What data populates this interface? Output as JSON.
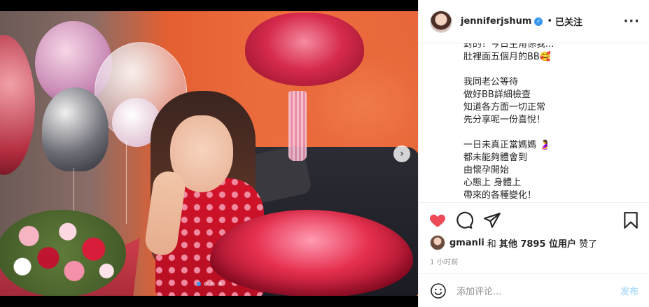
{
  "post": {
    "username": "jenniferjshum",
    "separator": "•",
    "follow_status": "已关注",
    "more_label": "···"
  },
  "caption": {
    "lines": [
      "對的！今日主角係我...",
      "肚裡面五個月的BB🥰",
      "",
      "我同老公等待",
      "做好BB詳細檢查",
      "知道各方面一切正常",
      "先分享呢一份喜悅！",
      "",
      "一日未真正當媽媽 🤰",
      "都未能夠體會到",
      "由懷孕開始",
      "心態上 身體上",
      "帶來的各種變化！"
    ]
  },
  "carousel": {
    "next_arrow": "›",
    "total_slides": 4,
    "active_slide": 1
  },
  "likes": {
    "user": "gmanli",
    "connector": "和",
    "others": "其他 7895 位用户",
    "verb": "赞了"
  },
  "timestamp": "1 小时前",
  "comment": {
    "placeholder": "添加评论...",
    "post_label": "发布"
  },
  "colors": {
    "like_red": "#ed4956",
    "verified_blue": "#3897f0",
    "post_disabled": "#b2dffc"
  },
  "icons": [
    "heart-icon",
    "comment-icon",
    "share-icon",
    "bookmark-icon",
    "emoji-icon",
    "verified-icon",
    "more-icon"
  ]
}
